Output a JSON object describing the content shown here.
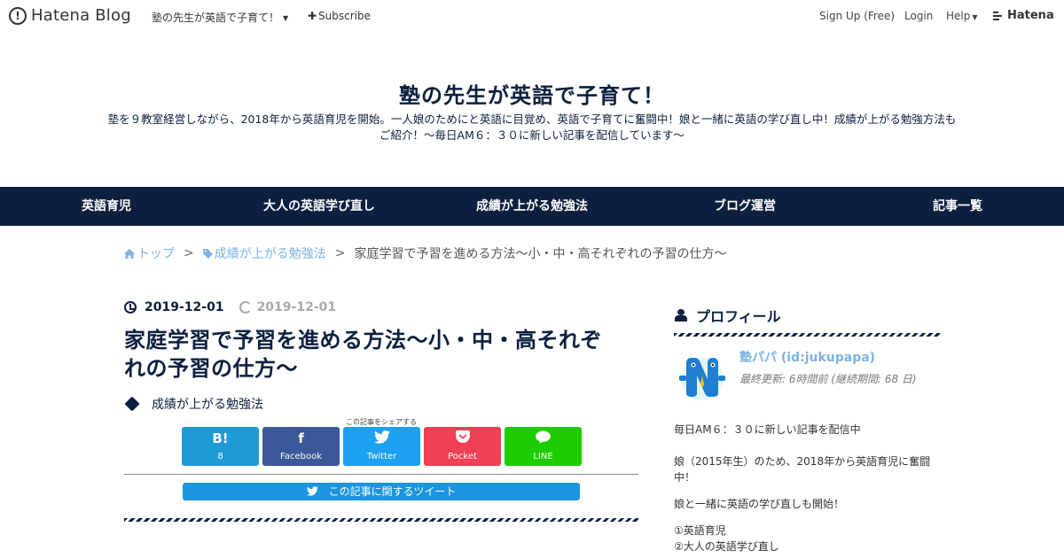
{
  "topbar": {
    "logo_text": "Hatena Blog",
    "blog_menu": "塾の先生が英語で子育て！",
    "subscribe": "Subscribe",
    "signup": "Sign Up (Free)",
    "login": "Login",
    "help": "Help",
    "brand": "Hatena"
  },
  "header": {
    "title": "塾の先生が英語で子育て！",
    "description_line1": "塾を９教室経営しながら、2018年から英語育児を開始。一人娘のためにと英語に目覚め、英語で子育てに奮闘中！娘と一緒に英語の学び直し中！成績が上がる勉強方法も",
    "description_line2": "ご紹介！～毎日AM６：３０に新しい記事を配信しています～"
  },
  "nav": {
    "items": [
      "英語育児",
      "大人の英語学び直し",
      "成績が上がる勉強法",
      "ブログ運営",
      "記事一覧"
    ]
  },
  "breadcrumb": {
    "home": "トップ",
    "category": "成績が上がる勉強法",
    "current": "家庭学習で予習を進める方法～小・中・高それぞれの予習の仕方～",
    "separator": ">"
  },
  "article": {
    "published": "2019-12-01",
    "updated": "2019-12-01",
    "title_line1": "家庭学習で予習を進める方法～小・中・高それぞ",
    "title_line2": "れの予習の仕方～",
    "category": "成績が上がる勉強法",
    "share_caption": "この記事をシェアする",
    "share": [
      {
        "icon": "B!",
        "label": "8",
        "color": "#1e9ad6"
      },
      {
        "icon": "f",
        "label": "Facebook",
        "color": "#3b5998"
      },
      {
        "icon": "t",
        "label": "Twitter",
        "color": "#1da1f2"
      },
      {
        "icon": "p",
        "label": "Pocket",
        "color": "#ef4056"
      },
      {
        "icon": "L",
        "label": "LINE",
        "color": "#1dcd00"
      }
    ],
    "tweet_label": "この記事に関するツイート"
  },
  "sidebar": {
    "profile_heading": "プロフィール",
    "profile_name": "塾パパ (id:jukupapa)",
    "profile_updated": "最終更新: 6時間前 (継続期間: 68 日)",
    "lines": [
      "毎日AM６：３０に新しい記事を配信中",
      "娘（2015年生）のため、2018年から英語育児に奮闘",
      "中！",
      "娘と一緒に英語の学び直しも開始！",
      "①英語育児",
      "②大人の英語学び直し"
    ]
  }
}
